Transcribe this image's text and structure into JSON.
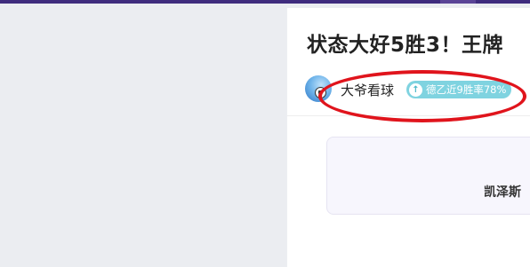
{
  "article": {
    "title": "状态大好5胜3！王牌",
    "author": {
      "name": "大爷看球",
      "avatar_icon": "soccer-ball-avatar"
    },
    "stat_badge": {
      "icon": "arrow-up-icon",
      "text": "德乙近9胜率78%"
    }
  },
  "card": {
    "text": "凯泽斯"
  },
  "colors": {
    "top_bar": "#3f2c7e",
    "badge": "#7fd3e0",
    "annotation": "#e0141c",
    "card_bg": "#f7f6fd"
  }
}
